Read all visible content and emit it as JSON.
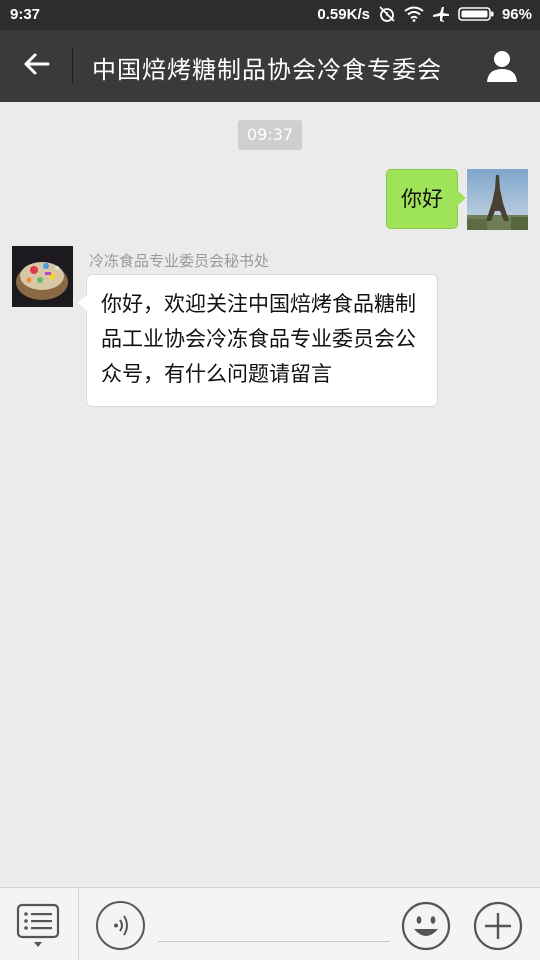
{
  "status_bar": {
    "time": "9:37",
    "net_speed": "0.59K/s",
    "battery": "96%"
  },
  "header": {
    "title": "中国焙烤糖制品协会冷食专委会"
  },
  "chat": {
    "timestamp": "09:37",
    "messages": [
      {
        "from": "self",
        "text": "你好"
      },
      {
        "from": "other",
        "sender": "冷冻食品专业委员会秘书处",
        "text": "你好，欢迎关注中国焙烤食品糖制品工业协会冷冻食品专业委员会公众号，有什么问题请留言"
      }
    ]
  },
  "input_bar": {
    "text_value": ""
  },
  "colors": {
    "self_bubble": "#9fe358",
    "title_bar": "#3a3a3c",
    "status_bar": "#2d2d2d",
    "chat_background": "#ebebeb"
  },
  "icons": {
    "back": "arrow-left-icon",
    "profile": "person-icon",
    "menu": "list-menu-icon",
    "voice": "voice-wave-icon",
    "emoji": "smiley-icon",
    "plus": "plus-icon"
  }
}
